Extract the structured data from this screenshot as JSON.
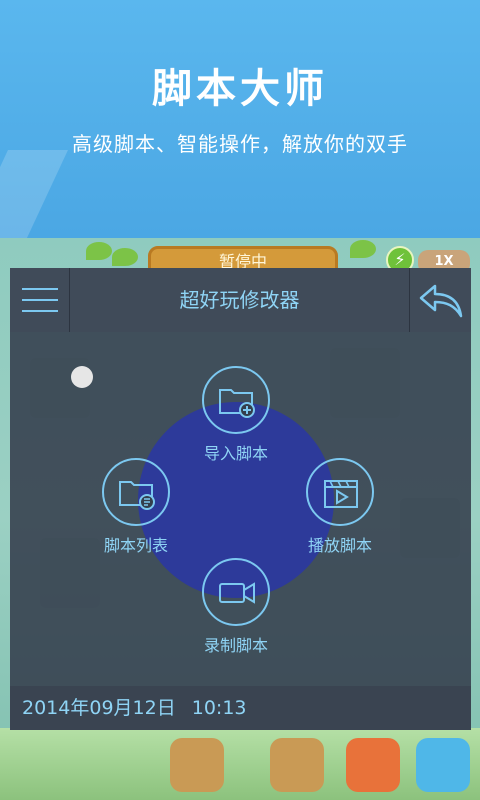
{
  "promo": {
    "title": "脚本大师",
    "subtitle": "高级脚本、智能操作，解放你的双手"
  },
  "game": {
    "status_text": "暂停中",
    "speed_label": "1X",
    "energy_icon": "lightning-icon"
  },
  "panel": {
    "title": "超好玩修改器",
    "menu_icon": "hamburger-menu-icon",
    "back_icon": "back-arrow-icon",
    "actions": [
      {
        "label": "导入脚本",
        "icon": "folder-add-icon"
      },
      {
        "label": "脚本列表",
        "icon": "folder-list-icon"
      },
      {
        "label": "播放脚本",
        "icon": "video-play-icon"
      },
      {
        "label": "录制脚本",
        "icon": "video-camera-icon"
      }
    ],
    "footer": {
      "datetime": "2014年09月12日 10:13"
    }
  },
  "colors": {
    "banner_blue": "#52aee8",
    "panel_bg": "#343e4c",
    "accent_cyan": "#7cc8f0",
    "disc_blue": "#2d3a9a"
  }
}
